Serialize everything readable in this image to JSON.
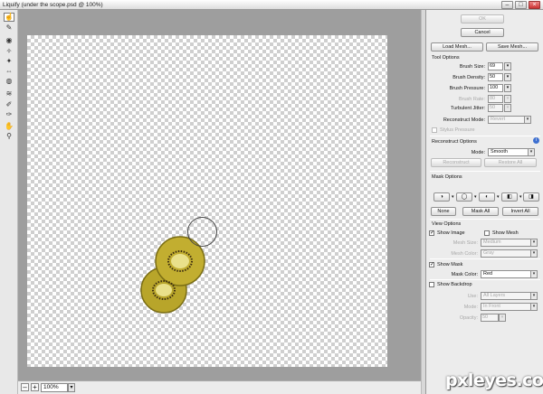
{
  "window": {
    "title": "Liquify (under the scope.psd @ 100%)",
    "buttons": {
      "minimize": "–",
      "maximize": "□",
      "close": "×"
    }
  },
  "toolbar": {
    "tools": [
      {
        "name": "forward-warp-tool",
        "glyph": "☝"
      },
      {
        "name": "reconstruct-tool",
        "glyph": "✎"
      },
      {
        "name": "twirl-tool",
        "glyph": "◉"
      },
      {
        "name": "pucker-tool",
        "glyph": "✧"
      },
      {
        "name": "bloat-tool",
        "glyph": "✦"
      },
      {
        "name": "push-left-tool",
        "glyph": "⇔"
      },
      {
        "name": "mirror-tool",
        "glyph": "◍"
      },
      {
        "name": "turbulence-tool",
        "glyph": "≋"
      },
      {
        "name": "freeze-mask-tool",
        "glyph": "✐"
      },
      {
        "name": "thaw-mask-tool",
        "glyph": "✑"
      },
      {
        "name": "hand-tool",
        "glyph": "✋"
      },
      {
        "name": "zoom-tool",
        "glyph": "⚲"
      }
    ]
  },
  "statusbar": {
    "zoom_out": "–",
    "zoom_in": "+",
    "zoom_value": "100%",
    "zoom_dropdown": "▾"
  },
  "panel": {
    "ok": "OK",
    "cancel": "Cancel",
    "load_mesh": "Load Mesh...",
    "save_mesh": "Save Mesh...",
    "tool_options": {
      "heading": "Tool Options",
      "brush_size": {
        "label": "Brush Size:",
        "value": "69"
      },
      "brush_density": {
        "label": "Brush Density:",
        "value": "50"
      },
      "brush_pressure": {
        "label": "Brush Pressure:",
        "value": "100"
      },
      "brush_rate": {
        "label": "Brush Rate:",
        "value": "80"
      },
      "turbulent_jitter": {
        "label": "Turbulent Jitter:",
        "value": "50"
      },
      "reconstruct_mode": {
        "label": "Reconstruct Mode:",
        "value": "Revert"
      },
      "stylus_pressure": "Stylus Pressure"
    },
    "reconstruct_options": {
      "heading": "Reconstruct Options",
      "mode_label": "Mode:",
      "mode_value": "Smooth",
      "reconstruct": "Reconstruct",
      "restore_all": "Restore All",
      "info_glyph": "i"
    },
    "mask_options": {
      "heading": "Mask Options",
      "icons": [
        "◑",
        "◯",
        "◐",
        "◧",
        "◨"
      ],
      "dropdown_glyph": "▾",
      "none": "None",
      "mask_all": "Mask All",
      "invert_all": "Invert All"
    },
    "view_options": {
      "heading": "View Options",
      "show_image": "Show Image",
      "show_mesh": "Show Mesh",
      "mesh_size_label": "Mesh Size:",
      "mesh_size_value": "Medium",
      "mesh_color_label": "Mesh Color:",
      "mesh_color_value": "Gray",
      "show_mask": "Show Mask",
      "mask_color_label": "Mask Color:",
      "mask_color_value": "Red",
      "show_backdrop": "Show Backdrop",
      "use_label": "Use:",
      "use_value": "All Layers",
      "mode_label": "Mode:",
      "mode_value": "In Front",
      "opacity_label": "Opacity:",
      "opacity_value": "50",
      "check_glyph": "✓",
      "dropdown_glyph": "▾"
    }
  },
  "watermark": "pxleyes.com",
  "colors": {
    "kiwi_flesh": "#b8a52a",
    "kiwi_core": "#e9e08a",
    "kiwi_seeds": "#3a2b10"
  }
}
